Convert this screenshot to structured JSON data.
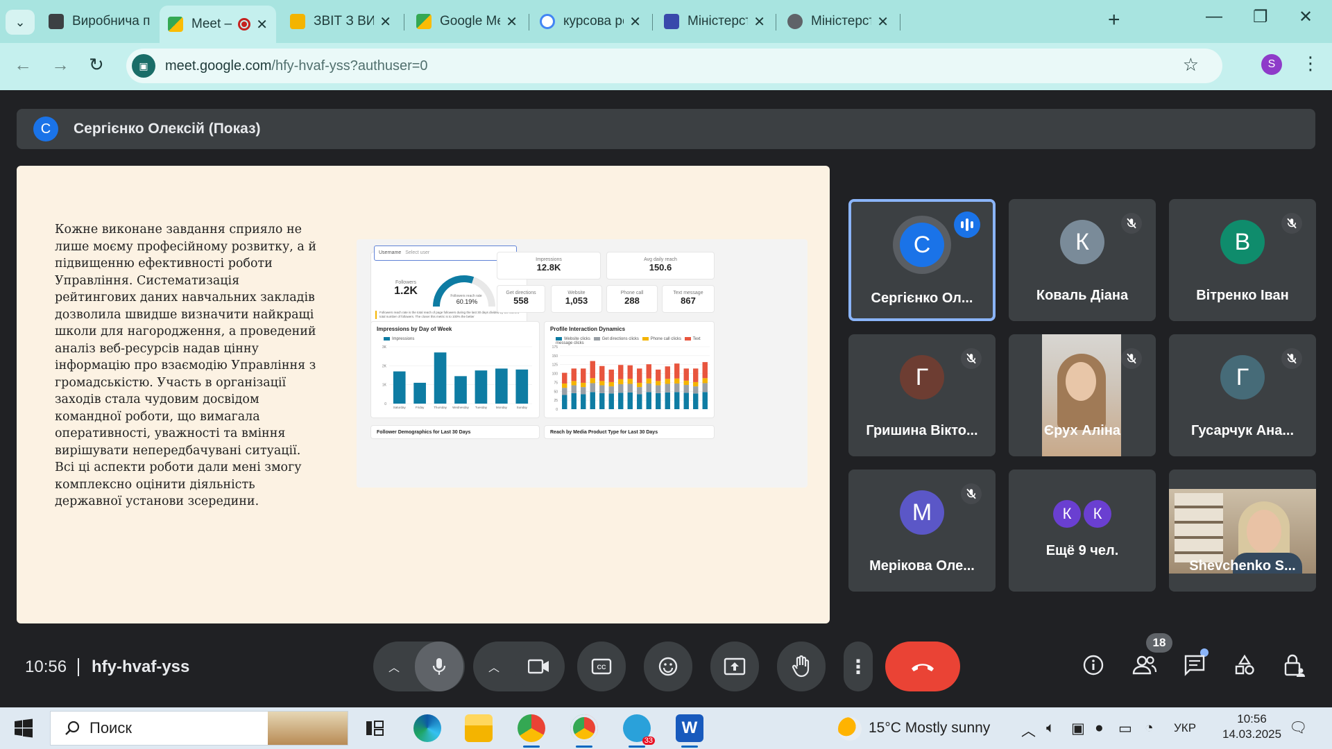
{
  "browser": {
    "tabs": [
      {
        "title": "Виробнича п",
        "favicon": "doc-icon",
        "color": "#3c4043"
      },
      {
        "title": "Meet – hfy",
        "favicon": "meet-icon",
        "active": true,
        "recording": true
      },
      {
        "title": "ЗВІТ З ВИРОБ",
        "favicon": "slides-icon",
        "color": "#f4b400"
      },
      {
        "title": "Google Meet",
        "favicon": "meet-icon"
      },
      {
        "title": "курсова робо",
        "favicon": "google-icon"
      },
      {
        "title": "Міністерство",
        "favicon": "crest-icon",
        "color": "#3949ab"
      },
      {
        "title": "Міністерство",
        "favicon": "globe-icon",
        "color": "#5f6368"
      }
    ],
    "url_host": "meet.google.com",
    "url_path": "/hfy-hvaf-yss?authuser=0",
    "profile_initial": "S"
  },
  "meeting": {
    "presenter_initial": "С",
    "presenter_label": "Сергієнко Олексій (Показ)",
    "time": "10:56",
    "code": "hfy-hvaf-yss",
    "participants_count": "18"
  },
  "slide": {
    "text": "Кожне виконане завдання сприяло не\nлише моєму професійному розвитку, а й\nпідвищенню ефективності роботи\nУправління. Систематизація\nрейтингових даних навчальних закладів\nдозволила швидше визначити найкращі\nшколи для нагородження, а проведений\nаналіз веб-ресурсів надав цінну\nінформацію про взаємодію Управління з\nгромадськістю. Участь в організації\nзаходів стала чудовим досвідом\nкомандної роботи, що вимагала\nоперативності, уважності та вміння\nвирішувати непередбачувані ситуації.\nВсі ці аспекти роботи дали мені змогу\nкомплексно оцінити діяльність\nдержавної установи зсередини.",
    "dashboard": {
      "select_label": "Username",
      "select_placeholder": "Select user",
      "followers_label": "Followers",
      "followers_value": "1.2K",
      "reach_rate_label": "Followers reach rate",
      "reach_rate_value": "60.19%",
      "reach_rate_fraction": 0.6019,
      "impressions_label": "Impressions",
      "impressions_value": "12.8K",
      "avg_reach_label": "Avg daily reach",
      "avg_reach_value": "150.6",
      "get_directions_label": "Get directions",
      "get_directions_value": "558",
      "website_label": "Website",
      "website_value": "1,053",
      "phone_label": "Phone call",
      "phone_value": "288",
      "text_label": "Text message",
      "text_value": "867",
      "note": "Followers reach rate is the total reach of page followers during the last 30 days divided by the current total number of followers. The closer this metric is to 100% the better",
      "chart1_title": "Impressions by Day of Week",
      "chart1_legend": "Impressions",
      "chart2_title": "Profile Interaction Dynamics",
      "chart2_legend": [
        "Website clicks",
        "Get directions clicks",
        "Phone call clicks",
        "Text message clicks"
      ],
      "demo_title": "Follower Demographics for Last 30 Days",
      "reach_title": "Reach by Media Product Type for Last 30 Days"
    }
  },
  "chart_data": [
    {
      "type": "bar",
      "title": "Impressions by Day of Week",
      "categories": [
        "Saturday",
        "Friday",
        "Thursday",
        "Wednesday",
        "Tuesday",
        "Monday",
        "Sunday"
      ],
      "series": [
        {
          "name": "Impressions",
          "values": [
            1700,
            1100,
            2700,
            1450,
            1750,
            1850,
            1800
          ]
        }
      ],
      "yticks": [
        "0",
        "1K",
        "2K",
        "3K"
      ],
      "ylim": [
        0,
        3000
      ],
      "color": "#0e7ca3"
    },
    {
      "type": "bar",
      "title": "Profile Interaction Dynamics",
      "stacked": true,
      "yticks": [
        "0",
        "25",
        "50",
        "75",
        "100",
        "125",
        "150",
        "175"
      ],
      "ylim": [
        0,
        175
      ],
      "series": [
        {
          "name": "Website clicks",
          "color": "#0e7ca3",
          "values": [
            40,
            45,
            42,
            48,
            45,
            44,
            46,
            47,
            42,
            48,
            45,
            47,
            48,
            46,
            44,
            48
          ]
        },
        {
          "name": "Get directions clicks",
          "color": "#9aa0a6",
          "values": [
            20,
            22,
            20,
            25,
            22,
            20,
            24,
            24,
            20,
            24,
            22,
            24,
            24,
            22,
            20,
            25
          ]
        },
        {
          "name": "Phone call clicks",
          "color": "#f4b400",
          "values": [
            12,
            12,
            12,
            14,
            12,
            12,
            14,
            14,
            12,
            14,
            12,
            14,
            14,
            12,
            12,
            14
          ]
        },
        {
          "name": "Text message clicks",
          "color": "#e8553e",
          "values": [
            30,
            35,
            40,
            48,
            42,
            35,
            40,
            38,
            40,
            40,
            32,
            35,
            42,
            34,
            38,
            45
          ]
        }
      ]
    }
  ],
  "tiles": [
    {
      "name": "Сергієнко Ол...",
      "initial": "С",
      "color": "#1a73e8",
      "speaking": true
    },
    {
      "name": "Коваль Діана",
      "initial": "К",
      "color": "#7a8b99",
      "muted": true
    },
    {
      "name": "Вітренко Іван",
      "initial": "В",
      "color": "#0f8c6c",
      "muted": true
    },
    {
      "name": "Гришина Вікто...",
      "initial": "Г",
      "color": "#6d3d32",
      "muted": true
    },
    {
      "name": "Єрух Аліна",
      "video": true,
      "muted": true
    },
    {
      "name": "Гусарчук Ана...",
      "initial": "Г",
      "color": "#466b78",
      "muted": true
    },
    {
      "name": "Мерікова Оле...",
      "initial": "М",
      "color": "#5b57c7",
      "muted": true
    },
    {
      "name": "Ещё 9 чел.",
      "others": [
        "К",
        "К"
      ]
    },
    {
      "name": "Shevchenko S...",
      "video": true
    }
  ],
  "taskbar": {
    "search_placeholder": "Поиск",
    "weather": "15°C  Mostly sunny",
    "lang": "УКР",
    "time": "10:56",
    "date": "14.03.2025",
    "telegram_badge": "33"
  }
}
